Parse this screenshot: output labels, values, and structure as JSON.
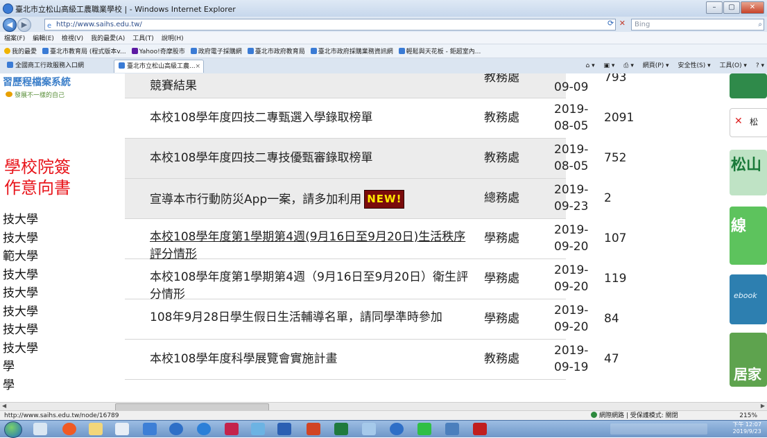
{
  "window": {
    "title": "臺北市立松山高級工農職業學校 | - Windows Internet Explorer",
    "controls": [
      "–",
      "▢",
      "✕"
    ]
  },
  "address_bar": {
    "url": "http://www.saihs.edu.tw/",
    "refresh": "⟳",
    "stop": "✕",
    "search_placeholder": "Bing",
    "search_icon": "search-icon"
  },
  "menu": [
    "檔案(F)",
    "編輯(E)",
    "檢視(V)",
    "我的最愛(A)",
    "工具(T)",
    "說明(H)"
  ],
  "favorites": [
    {
      "label": "我的最愛",
      "kind": "star"
    },
    {
      "label": "臺北市教育局 (程式版本v...",
      "kind": "ie"
    },
    {
      "label": "Yahoo!奇摩股市",
      "kind": "yahoo"
    },
    {
      "label": "政府電子採購網",
      "kind": "ie"
    },
    {
      "label": "臺北市政府教育局",
      "kind": "ie"
    },
    {
      "label": "臺北市政府採購業務資訊網",
      "kind": "ie"
    },
    {
      "label": "輕鬆與天花板 - 鉅超室內...",
      "kind": "ie"
    }
  ],
  "tabs": {
    "other": "全國商工行政服務入口網",
    "active": "臺北市立松山高級工農...",
    "commands": [
      "網頁(P) ▾",
      "安全性(S) ▾",
      "工具(O) ▾"
    ]
  },
  "left": {
    "banner_title": "習歷程檔案系統",
    "banner_sub": "發展不一樣的自己",
    "red_line1": "學校院簽",
    "red_line2": "作意向書",
    "schools": [
      "技大學",
      "技大學",
      "範大學",
      "技大學",
      "技大學",
      "技大學",
      "技大學",
      "技大學",
      "學",
      "學"
    ]
  },
  "rows": [
    {
      "title": "競賽結果",
      "dept": "教務處",
      "date": "09-09",
      "views": "793",
      "style": "gray"
    },
    {
      "title": "本校108學年度四技二專甄選入學錄取榜單",
      "dept": "教務處",
      "date": "2019-08-05",
      "views": "2091",
      "style": "white"
    },
    {
      "title": "本校108學年度四技二專技優甄審錄取榜單",
      "dept": "教務處",
      "date": "2019-08-05",
      "views": "752",
      "style": "gray"
    },
    {
      "title": "宣導本市行動防災App一案，請多加利用",
      "dept": "總務處",
      "date": "2019-09-23",
      "views": "2",
      "style": "gray",
      "badge": "NEW!"
    },
    {
      "title": "本校108學年度第1學期第4週(9月16日至9月20日)生活秩序評分情形",
      "dept": "學務處",
      "date": "2019-09-20",
      "views": "107",
      "style": "white",
      "link": true
    },
    {
      "title": "本校108學年度第1學期第4週（9月16日至9月20日）衛生評分情形",
      "dept": "學務處",
      "date": "2019-09-20",
      "views": "119",
      "style": "white"
    },
    {
      "title": "108年9月28日學生假日生活輔導名單，請同學準時參加",
      "dept": "學務處",
      "date": "2019-09-20",
      "views": "84",
      "style": "white"
    },
    {
      "title": "本校108學年度科學展覽會實施計畫",
      "dept": "教務處",
      "date": "2019-09-19",
      "views": "47",
      "style": "white"
    }
  ],
  "right_banners": {
    "b2": "松",
    "b3": "松山",
    "b4": "線",
    "b5": "ebook",
    "b6": "居家"
  },
  "status": {
    "url": "http://www.saihs.edu.tw/node/16789",
    "zone": "網際網路 | 受保護模式: 關閉",
    "zoom": "215%"
  },
  "taskbar": {
    "time": "下午 12:07",
    "date": "2019/9/23"
  }
}
